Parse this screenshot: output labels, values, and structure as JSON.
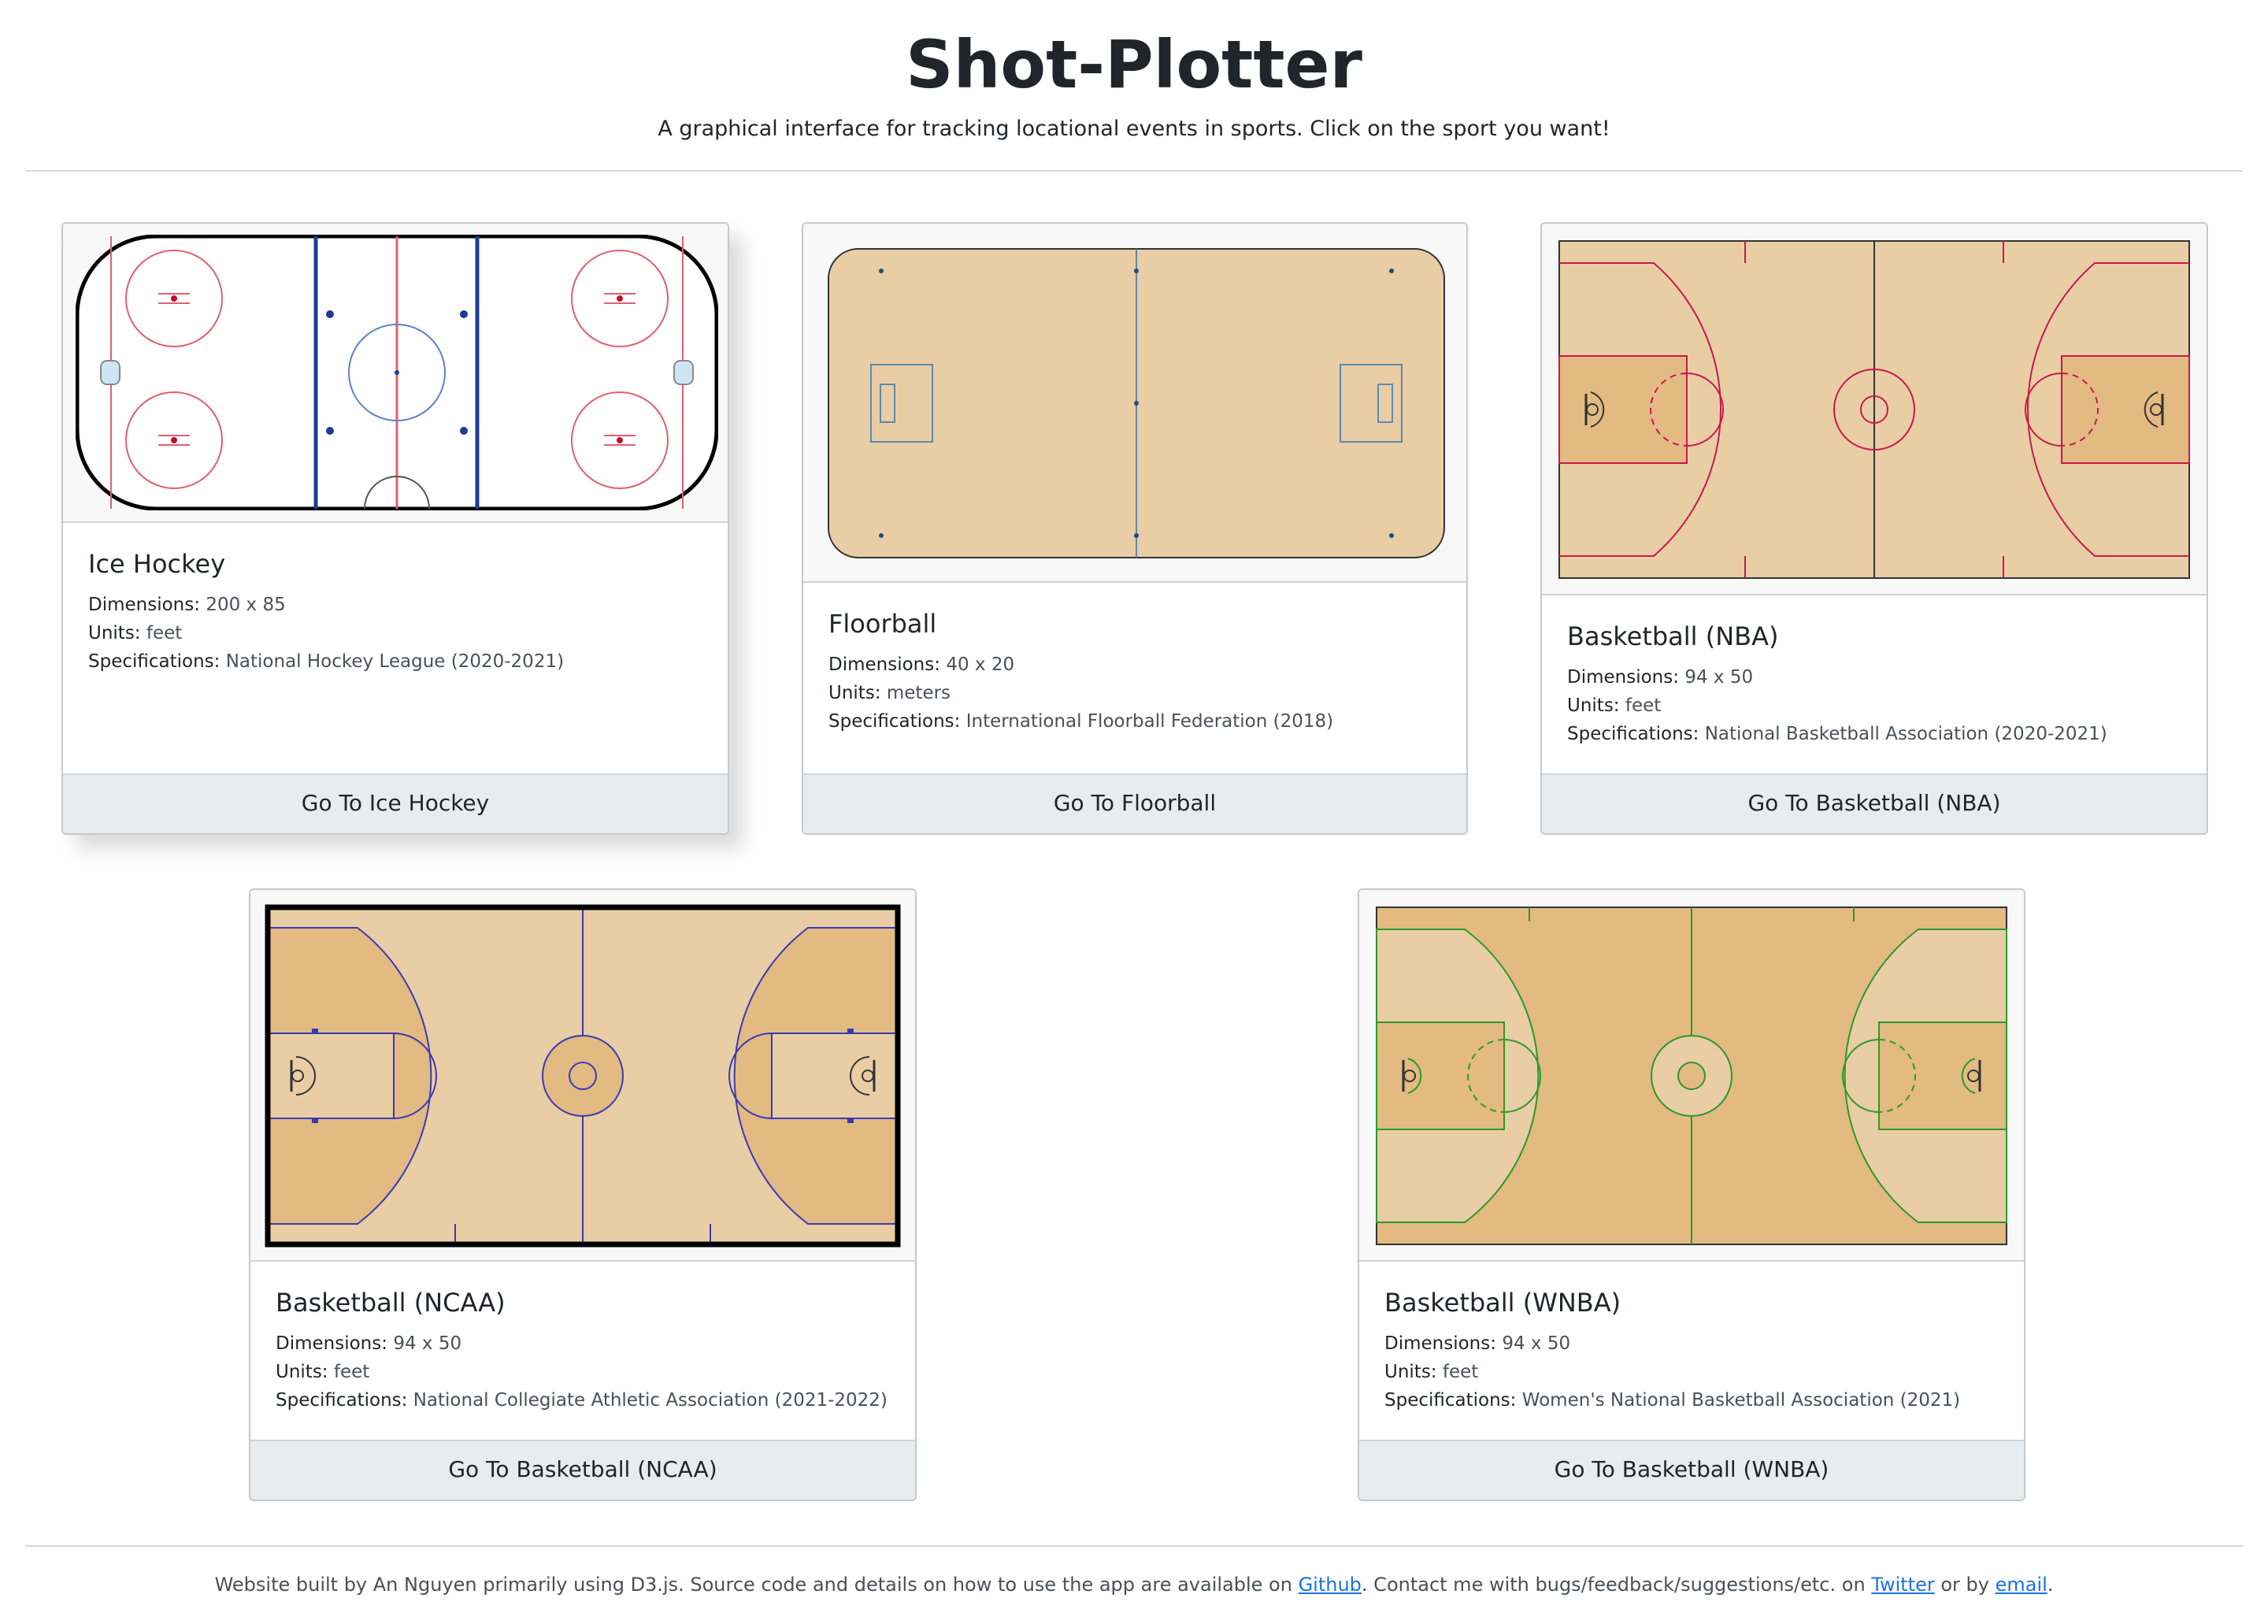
{
  "header": {
    "title": "Shot-Plotter",
    "subtitle": "A graphical interface for tracking locational events in sports. Click on the sport you want!"
  },
  "spec_keys": {
    "dimensions": "Dimensions:",
    "units": "Units:",
    "specifications": "Specifications:"
  },
  "cards": [
    {
      "title": "Ice Hockey",
      "dimensions": "200 x 85",
      "units": "feet",
      "specifications": "National Hockey League (2020-2021)",
      "button": "Go To Ice Hockey"
    },
    {
      "title": "Floorball",
      "dimensions": "40 x 20",
      "units": "meters",
      "specifications": "International Floorball Federation (2018)",
      "button": "Go To Floorball"
    },
    {
      "title": "Basketball (NBA)",
      "dimensions": "94 x 50",
      "units": "feet",
      "specifications": "National Basketball Association (2020-2021)",
      "button": "Go To Basketball (NBA)"
    },
    {
      "title": "Basketball (NCAA)",
      "dimensions": "94 x 50",
      "units": "feet",
      "specifications": "National Collegiate Athletic Association (2021-2022)",
      "button": "Go To Basketball (NCAA)"
    },
    {
      "title": "Basketball (WNBA)",
      "dimensions": "94 x 50",
      "units": "feet",
      "specifications": "Women's National Basketball Association (2021)",
      "button": "Go To Basketball (WNBA)"
    }
  ],
  "footer": {
    "text_before_github": "Website built by An Nguyen primarily using D3.js. Source code and details on how to use the app are available on ",
    "github_link": "Github",
    "text_after_github": ". Contact me with bugs/feedback/suggestions/etc. on ",
    "twitter_link": "Twitter",
    "text_between": " or by ",
    "email_link": "email",
    "text_end": "."
  },
  "colors": {
    "wood_light": "#e9cda5",
    "wood_dark": "#e2ba82",
    "nba_line": "#c8194b",
    "ncaa_line": "#3a3ab4",
    "wnba_line": "#2a9a2a",
    "hockey_red": "#e06070",
    "hockey_blue": "#1e3a96",
    "button_bg": "#e9ecef"
  }
}
